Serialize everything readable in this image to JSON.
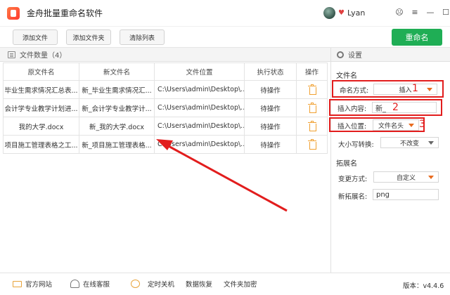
{
  "window": {
    "title": "金舟批量重命名软件",
    "username": "Lyan",
    "controls": [
      "☹",
      "≡",
      "—",
      "☐",
      "✕"
    ]
  },
  "toolbar": {
    "add_file": "添加文件",
    "add_folder": "添加文件夹",
    "clear_list": "清除列表",
    "rename": "重命名"
  },
  "list": {
    "header": "文件数量（4）",
    "columns": [
      "原文件名",
      "新文件名",
      "文件位置",
      "执行状态",
      "操作"
    ],
    "rows": [
      {
        "original": "毕业生需求情况汇总表...",
        "new": "新_毕业生需求情况汇...",
        "location": "C:\\Users\\admin\\Desktop\\...",
        "status": "待操作"
      },
      {
        "original": "会计学专业教学计划进...",
        "new": "新_会计学专业教学计...",
        "location": "C:\\Users\\admin\\Desktop\\...",
        "status": "待操作"
      },
      {
        "original": "我的大学.docx",
        "new": "新_我的大学.docx",
        "location": "C:\\Users\\admin\\Desktop\\...",
        "status": "待操作"
      },
      {
        "original": "项目施工管理表格之工...",
        "new": "新_项目施工管理表格...",
        "location": "C:\\Users\\admin\\Desktop\\...",
        "status": "待操作"
      }
    ]
  },
  "settings": {
    "header": "设置",
    "filename_section": "文件名",
    "naming_mode_label": "命名方式:",
    "naming_mode_value": "插入",
    "insert_content_label": "插入内容:",
    "insert_content_value": "新_",
    "insert_position_label": "插入位置:",
    "insert_position_value": "文件名头",
    "case_label": "大小写转换:",
    "case_value": "不改变",
    "ext_section": "拓展名",
    "change_mode_label": "变更方式:",
    "change_mode_value": "自定义",
    "new_ext_label": "新拓展名:",
    "new_ext_value": "png",
    "markers": [
      "1",
      "2",
      "3"
    ]
  },
  "statusbar": {
    "website": "官方网站",
    "support": "在线客服",
    "shutdown": "定时关机",
    "recovery": "数据恢复",
    "encrypt": "文件夹加密",
    "version": "版本：v4.4.6"
  },
  "colors": {
    "accent_green": "#1fae55",
    "annotation_red": "#e21d1d",
    "caret_orange": "#e86b1f",
    "trash_orange": "#f0a030"
  }
}
